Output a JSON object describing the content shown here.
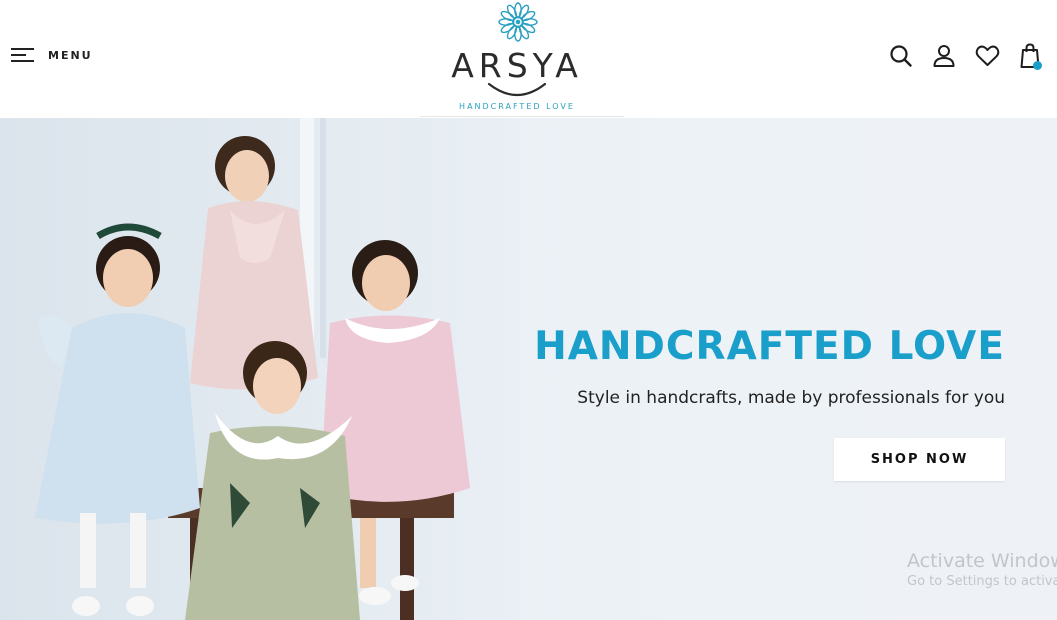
{
  "header": {
    "menu_label": "MENU",
    "logo": {
      "name": "ARSYA",
      "tagline": "HANDCRAFTED LOVE"
    },
    "icons": [
      "search-icon",
      "user-icon",
      "heart-icon",
      "shopping-bag-icon"
    ]
  },
  "hero": {
    "title": "HANDCRAFTED LOVE",
    "subtitle": "Style in handcrafts, made by professionals for you",
    "cta_label": "SHOP NOW"
  },
  "watermark": {
    "title": "Activate Windows",
    "subtitle": "Go to Settings to activa"
  },
  "colors": {
    "accent": "#1a9fcb",
    "text_dark": "#222222",
    "hero_bg": "#eaf0f5"
  }
}
